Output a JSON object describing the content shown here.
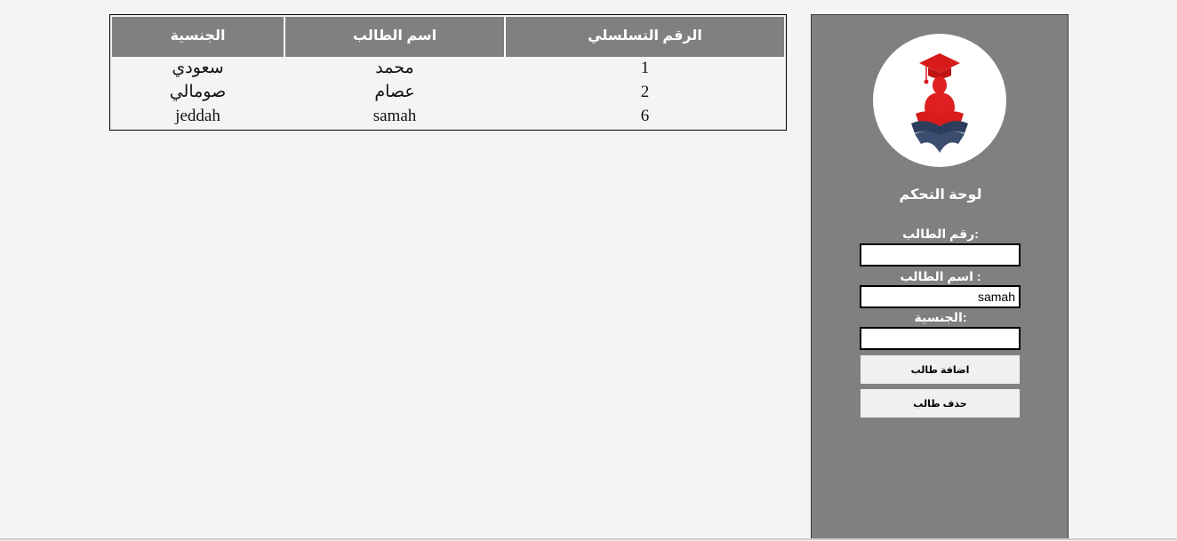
{
  "table": {
    "headers": {
      "serial": "الرقم التسلسلي",
      "name": "اسم الطالب",
      "nationality": "الجنسية"
    },
    "rows": [
      {
        "serial": "1",
        "name": "محمد",
        "nationality": "سعودي"
      },
      {
        "serial": "2",
        "name": "عصام",
        "nationality": "صومالي"
      },
      {
        "serial": "6",
        "name": "samah",
        "nationality": "jeddah"
      }
    ]
  },
  "sidebar": {
    "title": "لوحة التحكم",
    "fields": {
      "student_id": {
        "label": "رقم الطالب:",
        "value": ""
      },
      "student_name": {
        "label": "اسم الطالب :",
        "value": "samah"
      },
      "nationality": {
        "label": "الجنسية:",
        "value": ""
      }
    },
    "buttons": {
      "add": "اضافة طالب",
      "delete": "حذف طالب"
    },
    "logo_icon": "graduate-reading-book-icon"
  },
  "colors": {
    "header_bg": "#808080",
    "sidebar_bg": "#808080",
    "logo_red": "#d81b1b",
    "logo_navy": "#2d3e5c"
  }
}
